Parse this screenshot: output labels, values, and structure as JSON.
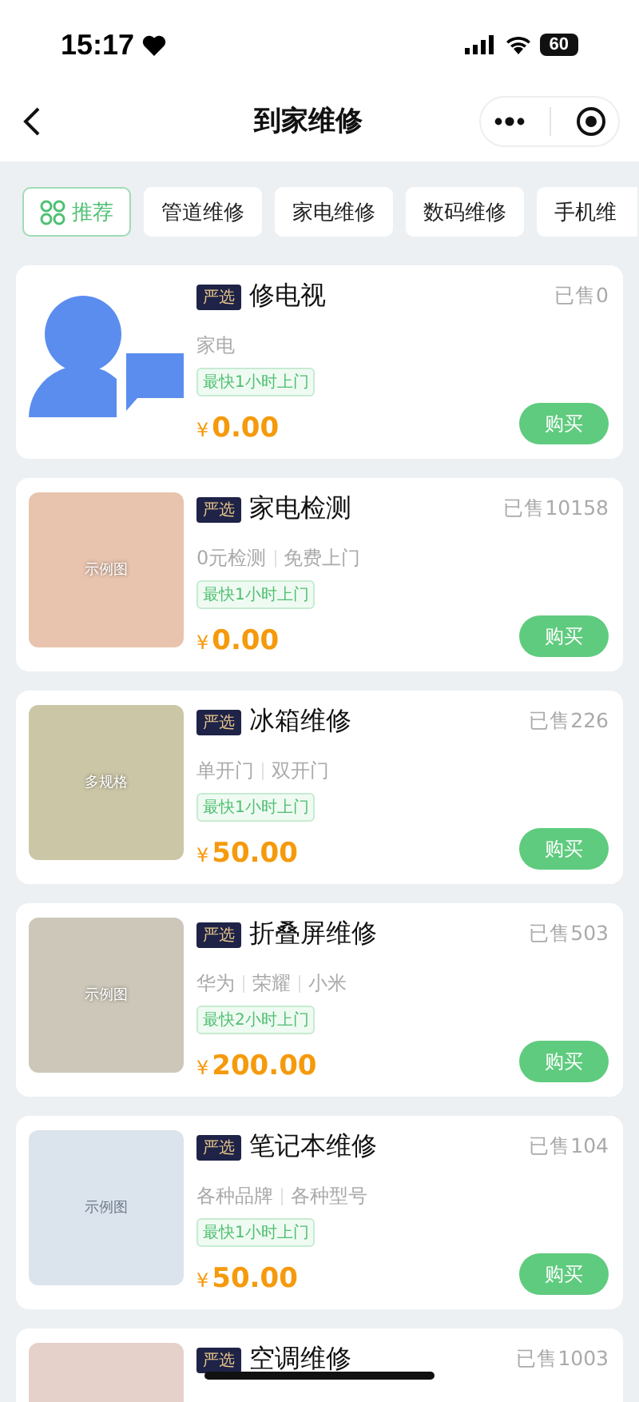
{
  "status_bar": {
    "time": "15:17",
    "battery": "60"
  },
  "nav": {
    "title": "到家维修"
  },
  "categories": [
    {
      "label": "推荐",
      "selected": true
    },
    {
      "label": "管道维修",
      "selected": false
    },
    {
      "label": "家电维修",
      "selected": false
    },
    {
      "label": "数码维修",
      "selected": false
    },
    {
      "label": "手机维",
      "selected": false
    }
  ],
  "products": [
    {
      "image": {
        "kind": "icon"
      },
      "badge": "严选",
      "title": "修电视",
      "sold": "已售0",
      "tags": [
        "家电"
      ],
      "eta": "最快1小时上门",
      "currency": "¥",
      "price": "0.00",
      "button": "购买"
    },
    {
      "image": {
        "kind": "placeholder",
        "color": "#e8c4ae",
        "label": "示例图"
      },
      "badge": "严选",
      "title": "家电检测",
      "sold": "已售10158",
      "tags": [
        "0元检测",
        "免费上门"
      ],
      "eta": "最快1小时上门",
      "currency": "¥",
      "price": "0.00",
      "button": "购买"
    },
    {
      "image": {
        "kind": "placeholder",
        "color": "#cbc6a6",
        "label": "多规格"
      },
      "badge": "严选",
      "title": "冰箱维修",
      "sold": "已售226",
      "tags": [
        "单开门",
        "双开门"
      ],
      "eta": "最快1小时上门",
      "currency": "¥",
      "price": "50.00",
      "button": "购买"
    },
    {
      "image": {
        "kind": "placeholder",
        "color": "#ccc7b9",
        "label": "示例图"
      },
      "badge": "严选",
      "title": "折叠屏维修",
      "sold": "已售503",
      "tags": [
        "华为",
        "荣耀",
        "小米"
      ],
      "eta": "最快2小时上门",
      "currency": "¥",
      "price": "200.00",
      "button": "购买"
    },
    {
      "image": {
        "kind": "placeholder",
        "color": "#dbe3ec",
        "label": "示例图"
      },
      "badge": "严选",
      "title": "笔记本维修",
      "sold": "已售104",
      "tags": [
        "各种品牌",
        "各种型号"
      ],
      "eta": "最快1小时上门",
      "currency": "¥",
      "price": "50.00",
      "button": "购买"
    },
    {
      "image": {
        "kind": "placeholder",
        "color": "#e6d0ca"
      },
      "badge": "严选",
      "title": "空调维修",
      "sold": "已售1003"
    }
  ]
}
